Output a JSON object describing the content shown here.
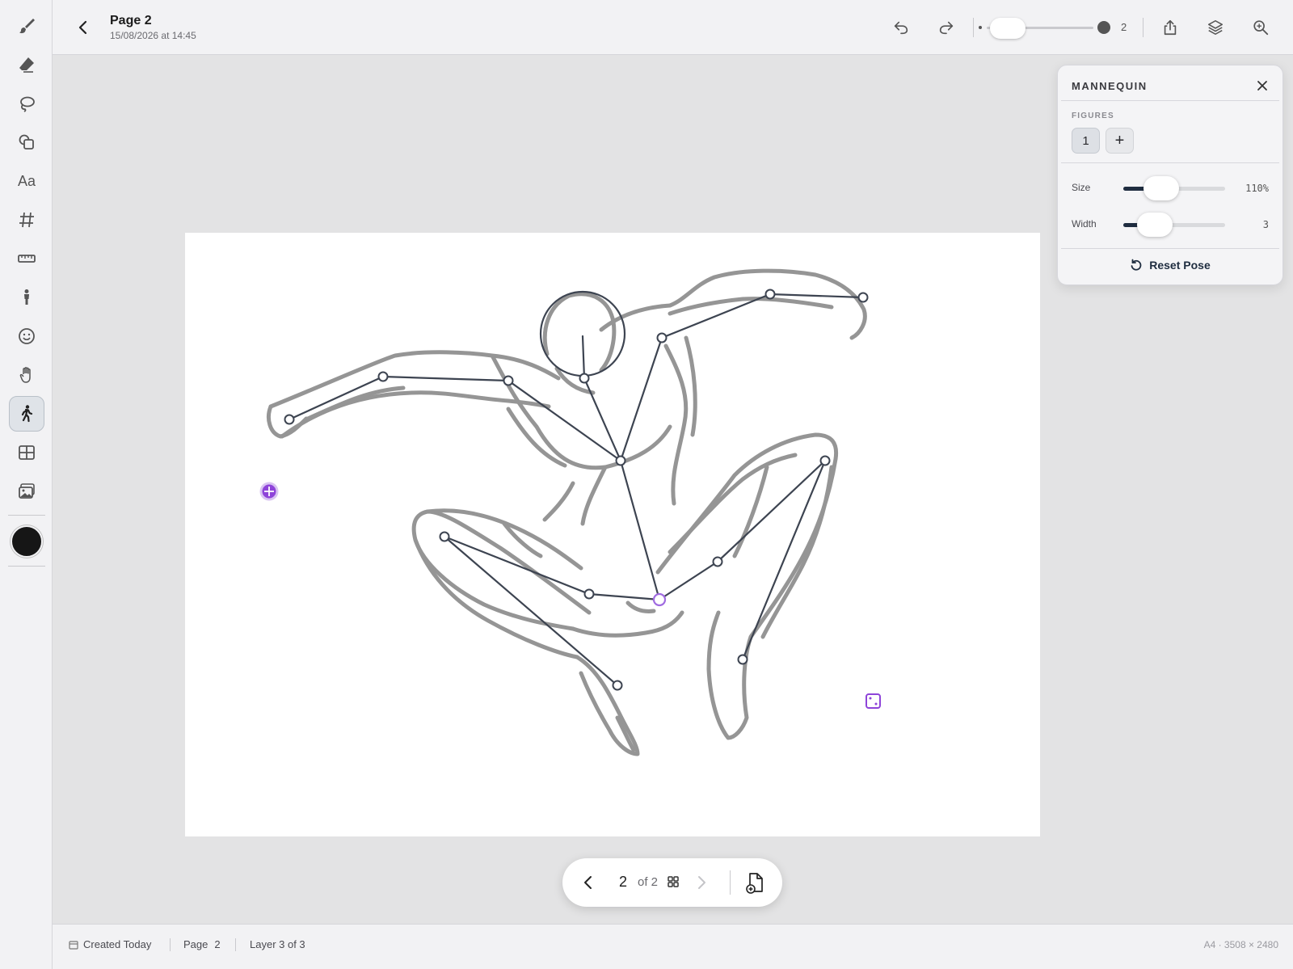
{
  "header": {
    "title": "Page 2",
    "subtitle": "15/08/2026 at 14:45",
    "brush_size_value": "2"
  },
  "panel": {
    "title": "MANNEQUIN",
    "figures_label": "FIGURES",
    "figure_button": "1",
    "add_figure": "+",
    "size_label": "Size",
    "size_value": "110%",
    "size_fraction": 0.37,
    "width_label": "Width",
    "width_value": "3",
    "width_fraction": 0.31,
    "reset_label": "Reset Pose"
  },
  "pager": {
    "current": "2",
    "of_label": "of 2"
  },
  "status": {
    "created": "Created Today",
    "page_label": "Page",
    "page_value": "2",
    "layer": "Layer 3 of 3",
    "doc_size": "A4 · 3508 × 2480"
  },
  "toolbar": {
    "text_tool_label": "Aa"
  },
  "colors": {
    "accent": "#1f2d40",
    "handle": "#8e44d9",
    "current_color": "#161616"
  }
}
